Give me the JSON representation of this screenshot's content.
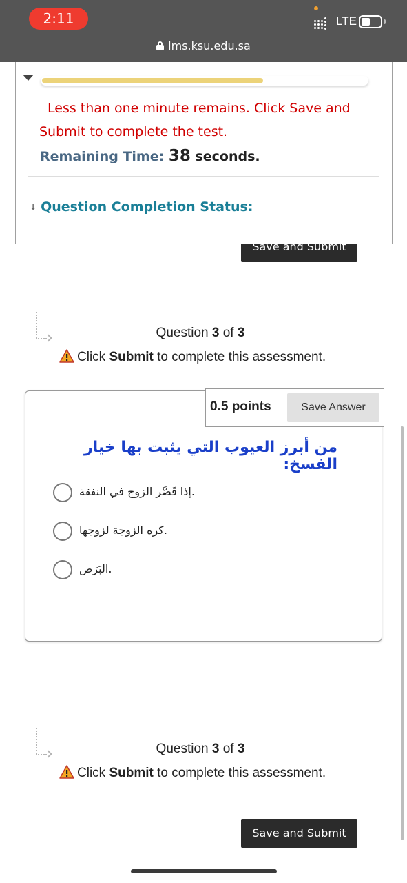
{
  "status_bar": {
    "time": "2:11",
    "network": "LTE",
    "url": "lms.ksu.edu.sa"
  },
  "timer": {
    "progress_fraction": 0.68,
    "warning": "Less than one minute remains. Click Save and Submit to complete the test.",
    "remaining_label": "Remaining Time:",
    "remaining_value": "38",
    "remaining_unit": "seconds.",
    "completion_status_label": "Question Completion Status:"
  },
  "buttons": {
    "save_submit_top": "Save and Submit",
    "save_submit_bottom": "Save and Submit",
    "save_answer": "Save Answer"
  },
  "question_header": {
    "prefix": "Question ",
    "current": "3",
    "of": " of ",
    "total": "3",
    "instr_pre": "Click ",
    "instr_bold": "Submit",
    "instr_post": " to complete this assessment."
  },
  "question": {
    "points": "0.5 points",
    "text": "من أبرز العيوب التي يثبت بها خيار الفسخ:",
    "options": [
      ".إذا قَصَّر الزوج في النفقة",
      ".كره الزوجة لزوجها",
      ".البَرَص"
    ]
  },
  "colors": {
    "warning_red": "#d00000",
    "question_blue": "#1a3fc9",
    "status_teal": "#1a7f97",
    "progress_yellow": "#ecd379"
  }
}
